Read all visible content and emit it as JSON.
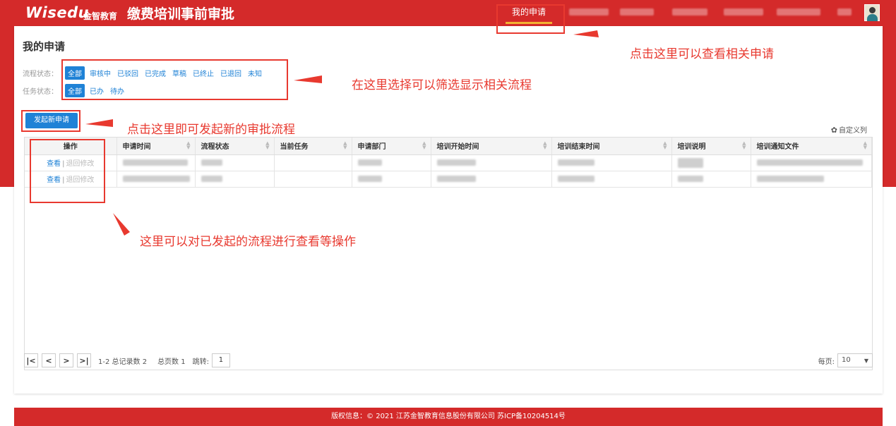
{
  "header": {
    "logo_wordmark": "Wisedu",
    "logo_cn": "金智教育",
    "app_title": "缴费培训事前审批",
    "nav_active": "我的申请"
  },
  "page": {
    "title": "我的申请",
    "flow_status": {
      "label": "流程状态：",
      "options": [
        "全部",
        "审核中",
        "已驳回",
        "已完成",
        "草稿",
        "已终止",
        "已退回",
        "未知"
      ],
      "selected": "全部"
    },
    "task_status": {
      "label": "任务状态：",
      "options": [
        "全部",
        "已办",
        "待办"
      ],
      "selected": "全部"
    },
    "new_button": "发起新申请",
    "custom_columns": "自定义列"
  },
  "table": {
    "columns": [
      "操作",
      "申请时间",
      "流程状态",
      "当前任务",
      "申请部门",
      "培训开始时间",
      "培训结束时间",
      "培训说明",
      "培训通知文件"
    ],
    "rows": [
      {
        "view": "查看",
        "separator": "|",
        "revoke": "退回修改"
      },
      {
        "view": "查看",
        "separator": "|",
        "revoke": "退回修改"
      }
    ]
  },
  "pager": {
    "first": "|<",
    "prev": "<",
    "next": ">",
    "last": ">|",
    "summary": "1-2 总记录数 2",
    "total_pages": "总页数 1",
    "jump_label": "跳转:",
    "jump_value": "1",
    "per_page_label": "每页:",
    "per_page_value": "10"
  },
  "footer": {
    "text": "版权信息：© 2021 江苏金智教育信息股份有限公司 苏ICP备10204514号"
  },
  "annotations": {
    "nav": "点击这里可以查看相关申请",
    "filter": "在这里选择可以筛选显示相关流程",
    "new": "点击这里即可发起新的审批流程",
    "ops": "这里可以对已发起的流程进行查看等操作"
  },
  "colors": {
    "brand_red": "#d42a2a",
    "primary_blue": "#1f82d6",
    "annotation_red": "#e8392f"
  }
}
